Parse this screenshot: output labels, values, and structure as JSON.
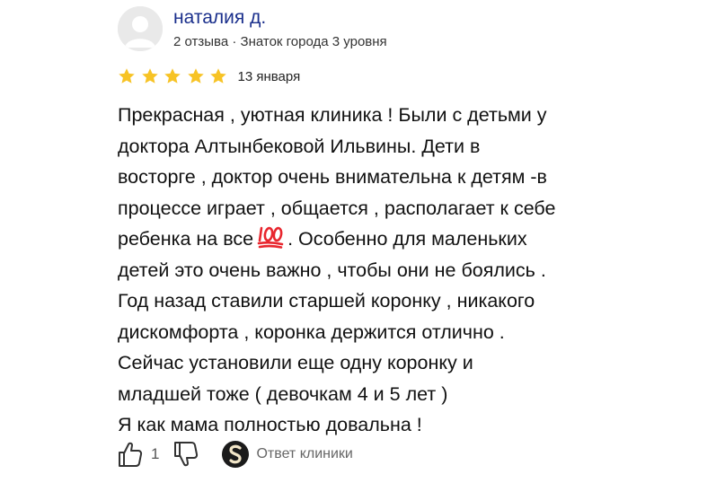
{
  "review": {
    "author": {
      "name": "наталия д.",
      "meta": "2 отзыва · Знаток города 3 уровня"
    },
    "rating": {
      "stars": 5,
      "max_stars": 5
    },
    "date": "13 января",
    "text_lines": [
      "Прекрасная , уютная клиника ! Были с детьми у",
      "доктора Алтынбековой Ильвины. Дети в",
      "восторге , доктор очень внимательна к детям -в",
      "процессе играет , общается , располагает к себе",
      "ребенка на все",
      ". Особенно для маленьких",
      "детей это очень важно , чтобы они не боялись .",
      "Год назад ставили старшей коронку , никакого",
      "дискомфорта , коронка держится отлично .",
      "Сейчас установили еще одну коронку и",
      "младшей тоже ( девочкам 4 и 5 лет )",
      "Я как мама полностью довальна !"
    ],
    "emoji": "hundred-points-icon",
    "actions": {
      "like_count": "1",
      "reply_label": "Ответ клиники"
    }
  },
  "colors": {
    "author_link": "#1a2f8c",
    "star": "#f7c325",
    "text": "#111111",
    "muted": "#666666",
    "emoji_red": "#e8262e"
  },
  "icons": {
    "avatar": "user-avatar-icon",
    "star": "star-icon",
    "like": "thumbs-up-icon",
    "dislike": "thumbs-down-icon",
    "clinic": "clinic-logo-icon"
  }
}
